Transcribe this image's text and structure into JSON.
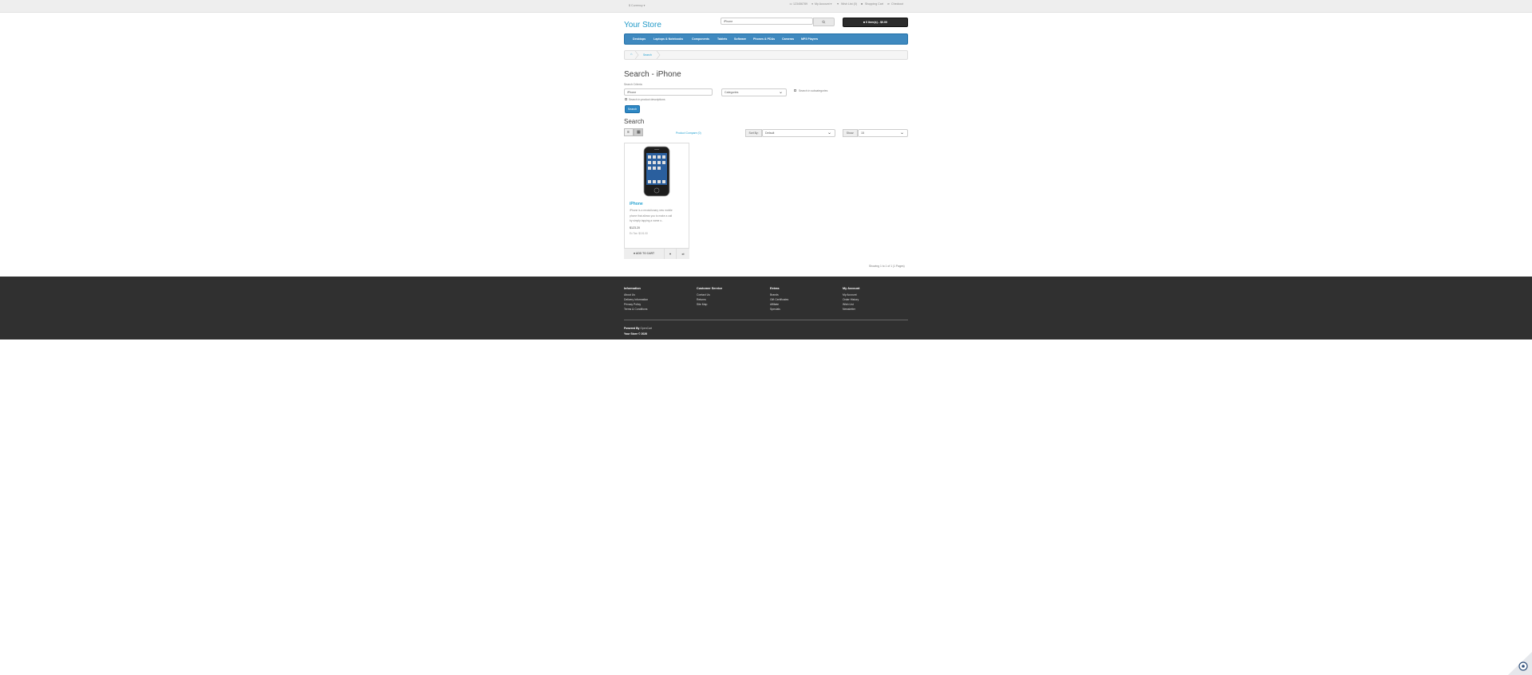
{
  "topbar": {
    "currency": "$ Currency ▾",
    "phone": "123456789",
    "my_account": "My Account ▾",
    "wish_list": "Wish List (0)",
    "shopping_cart": "Shopping Cart",
    "checkout": "Checkout"
  },
  "header": {
    "logo": "Your Store",
    "search_value": "iPhone",
    "cart_button": "0 item(s) - $0.00"
  },
  "menu": [
    "Desktops",
    "Laptops & Notebooks",
    "Components",
    "Tablets",
    "Software",
    "Phones & PDAs",
    "Cameras",
    "MP3 Players"
  ],
  "breadcrumb": {
    "current": "Search"
  },
  "page": {
    "title": "Search - iPhone",
    "criteria_label": "Search Criteria",
    "keyword_value": "iPhone",
    "category_value": "Categories",
    "subcategories_label": "Search in subcategories",
    "description_label": "Search in product descriptions",
    "search_button": "Search",
    "results_title": "Search",
    "compare_link": "Product Compare (0)",
    "sort_label": "Sort By:",
    "sort_value": "Default",
    "show_label": "Show:",
    "show_value": "15",
    "pagination_text": "Showing 1 to 1 of 1 (1 Pages)"
  },
  "product": {
    "name": "iPhone",
    "desc_line1": "iPhone is a revolutionary new mobile",
    "desc_line2": "phone that allows you to make a call",
    "desc_line3": "by simply tapping a name o..",
    "price": "$123.20",
    "ex_tax": "Ex Tax: $101.00",
    "add_to_cart": "ADD TO CART"
  },
  "footer": {
    "columns": [
      {
        "title": "Information",
        "links": [
          "About Us",
          "Delivery Information",
          "Privacy Policy",
          "Terms & Conditions"
        ]
      },
      {
        "title": "Customer Service",
        "links": [
          "Contact Us",
          "Returns",
          "Site Map"
        ]
      },
      {
        "title": "Extras",
        "links": [
          "Brands",
          "Gift Certificates",
          "Affiliate",
          "Specials"
        ]
      },
      {
        "title": "My Account",
        "links": [
          "My Account",
          "Order History",
          "Wish List",
          "Newsletter"
        ]
      }
    ],
    "powered_by_label": "Powered By",
    "powered_by_link": "OpenCart",
    "copyright": "Your Store © 2026"
  },
  "colors": {
    "accent": "#229ac8",
    "menu": "#3f89bf",
    "footer": "#303030",
    "cart": "#2c2c2c"
  }
}
